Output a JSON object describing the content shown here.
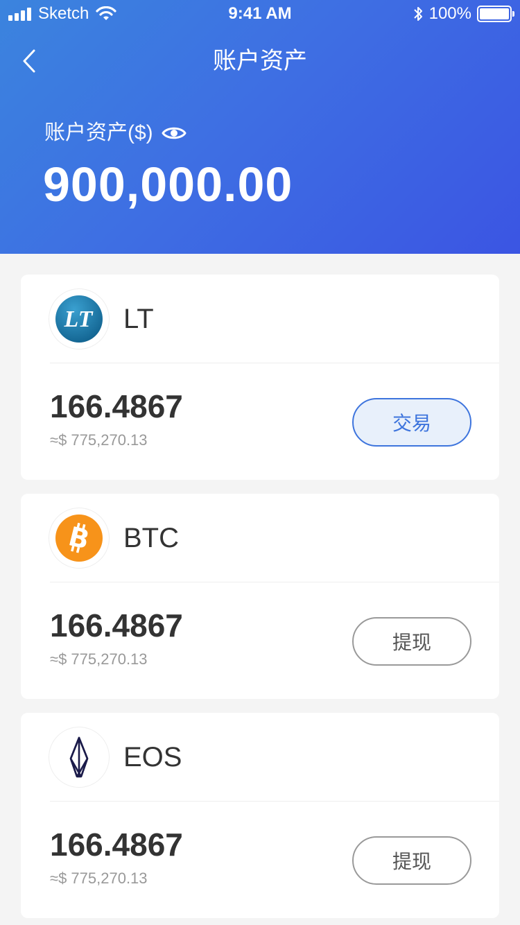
{
  "status_bar": {
    "carrier": "Sketch",
    "time": "9:41 AM",
    "battery": "100%"
  },
  "nav": {
    "title": "账户资产",
    "back_icon": "chevron-left-icon"
  },
  "summary": {
    "label": "账户资产($)",
    "eye_icon": "eye-icon",
    "total": "900,000.00"
  },
  "assets": [
    {
      "name": "LT",
      "icon": "lt-coin-icon",
      "amount": "166.4867",
      "usd": "≈$ 775,270.13",
      "action": "交易",
      "action_style": "primary"
    },
    {
      "name": "BTC",
      "icon": "bitcoin-icon",
      "amount": "166.4867",
      "usd": "≈$ 775,270.13",
      "action": "提现",
      "action_style": "default"
    },
    {
      "name": "EOS",
      "icon": "eos-icon",
      "amount": "166.4867",
      "usd": "≈$ 775,270.13",
      "action": "提现",
      "action_style": "default"
    }
  ],
  "colors": {
    "header_gradient_start": "#3b84de",
    "header_gradient_end": "#3b55e3",
    "primary": "#3d74dd",
    "bitcoin": "#f7931a",
    "lt_blue": "#1f77a8",
    "eos_dark": "#1b1b4a"
  }
}
